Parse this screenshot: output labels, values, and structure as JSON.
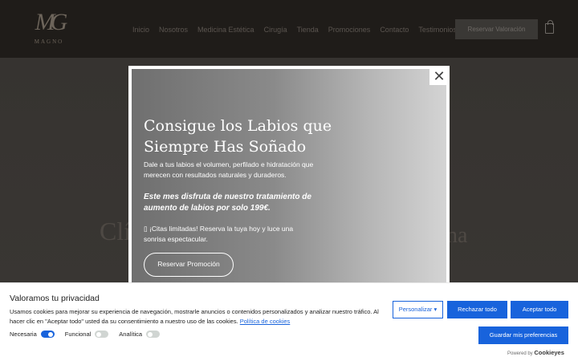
{
  "header": {
    "logo_text": "MG",
    "logo_word": "MAGNO",
    "nav": [
      "Inicio",
      "Nosotros",
      "Medicina Estética",
      "Cirugía",
      "Tienda",
      "Promociones",
      "Contacto",
      "Testimonios"
    ],
    "cta": "Reservar Valoración",
    "cart_icon": "shopping-bag-icon"
  },
  "hero": {
    "text_left": "Clí",
    "text_right": "na"
  },
  "popup": {
    "title": "Consigue los Labios que Siempre Has Soñado",
    "description": "Dale a tus labios el volumen, perfilado e hidratación que merecen con resultados naturales y duraderos.",
    "offer": "Este mes disfruta de nuestro tratamiento de aumento de labios por solo 199€.",
    "note": "▯ ¡Citas limitadas! Reserva la tuya hoy y luce una sonrisa espectacular.",
    "button": "Reservar Promoción",
    "close": "✕"
  },
  "cookie": {
    "title": "Valoramos tu privacidad",
    "text": "Usamos cookies para mejorar su experiencia de navegación, mostrarle anuncios o contenidos personalizados y analizar nuestro tráfico. Al hacer clic en \"Aceptar todo\" usted da su consentimiento a nuestro uso de las cookies.",
    "link": "Política de cookies",
    "toggles": [
      {
        "label": "Necesaria",
        "on": true
      },
      {
        "label": "Funcional",
        "on": false
      },
      {
        "label": "Analítica",
        "on": false
      }
    ],
    "customize": "Personalizar",
    "reject": "Rechazar todo",
    "accept": "Aceptar todo",
    "save": "Guardar mis preferencias",
    "powered_by": "Powered by",
    "brand": "Cookieyes"
  },
  "colors": {
    "accent": "#1863dc",
    "header_bg": "#1f1c19"
  }
}
